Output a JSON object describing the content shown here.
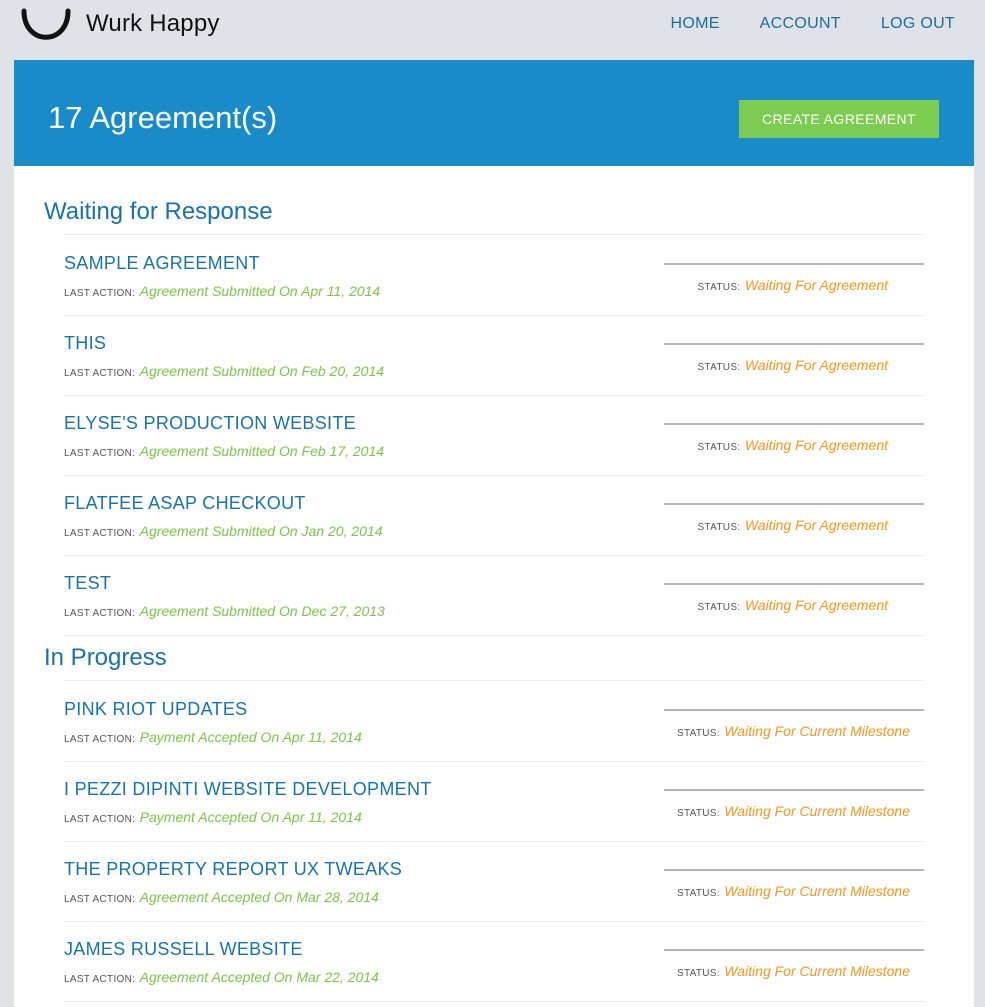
{
  "app": {
    "name": "Wurk Happy",
    "logo_icon": "smile-arc-icon"
  },
  "nav": [
    "HOME",
    "ACCOUNT",
    "LOG OUT"
  ],
  "header": {
    "title": "17 Agreement(s)",
    "create_button": "CREATE AGREEMENT"
  },
  "colors": {
    "header_blue": "#1a8bc9",
    "button_green": "#7ccc52",
    "title_blue": "#1773a8",
    "action_green": "#7bc44a",
    "status_orange": "#f7941d"
  },
  "labels": {
    "last_action": "LAST ACTION:",
    "status": "STATUS:"
  },
  "sections": [
    {
      "title": "Waiting for Response",
      "items": [
        {
          "title": "SAMPLE AGREEMENT",
          "last_action": "Agreement Submitted On Apr 11, 2014",
          "status": "Waiting For Agreement"
        },
        {
          "title": "THIS",
          "last_action": "Agreement Submitted On Feb 20, 2014",
          "status": "Waiting For Agreement"
        },
        {
          "title": "ELYSE'S PRODUCTION WEBSITE",
          "last_action": "Agreement Submitted On Feb 17, 2014",
          "status": "Waiting For Agreement"
        },
        {
          "title": "FLATFEE ASAP CHECKOUT",
          "last_action": "Agreement Submitted On Jan 20, 2014",
          "status": "Waiting For Agreement"
        },
        {
          "title": "TEST",
          "last_action": "Agreement Submitted On Dec 27, 2013",
          "status": "Waiting For Agreement"
        }
      ]
    },
    {
      "title": "In Progress",
      "items": [
        {
          "title": "PINK RIOT UPDATES",
          "last_action": "Payment Accepted On Apr 11, 2014",
          "status": "Waiting For Current Milestone"
        },
        {
          "title": "I PEZZI DIPINTI WEBSITE DEVELOPMENT",
          "last_action": "Payment Accepted On Apr 11, 2014",
          "status": "Waiting For Current Milestone"
        },
        {
          "title": "THE PROPERTY REPORT UX TWEAKS",
          "last_action": "Agreement Accepted On Mar 28, 2014",
          "status": "Waiting For Current Milestone"
        },
        {
          "title": "JAMES RUSSELL WEBSITE",
          "last_action": "Agreement Accepted On Mar 22, 2014",
          "status": "Waiting For Current Milestone"
        }
      ]
    }
  ]
}
